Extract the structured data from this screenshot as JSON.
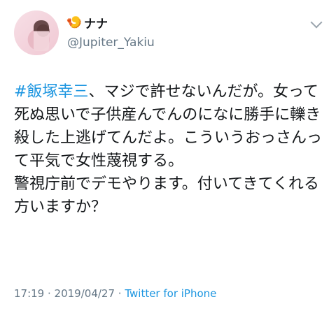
{
  "user": {
    "display_name": "ナナ",
    "handle": "@Jupiter_Yakiu",
    "name_emoji": "🍤"
  },
  "tweet": {
    "hashtag": "#飯塚幸三",
    "body": "、マジで許せないんだが。女って死ぬ思いで子供産んでんのになに勝手に轢き殺した上逃げてんだよ。こういうおっさんって平気で女性蔑視する。\n警視庁前でデモやります。付いてきてくれる方いますか？"
  },
  "meta": {
    "time": "17:19",
    "separator1": " · ",
    "date": "2019/04/27",
    "separator2": " · ",
    "source": "Twitter for iPhone"
  },
  "colors": {
    "link": "#1b95e0",
    "text": "#14171a",
    "secondary": "#657786"
  }
}
